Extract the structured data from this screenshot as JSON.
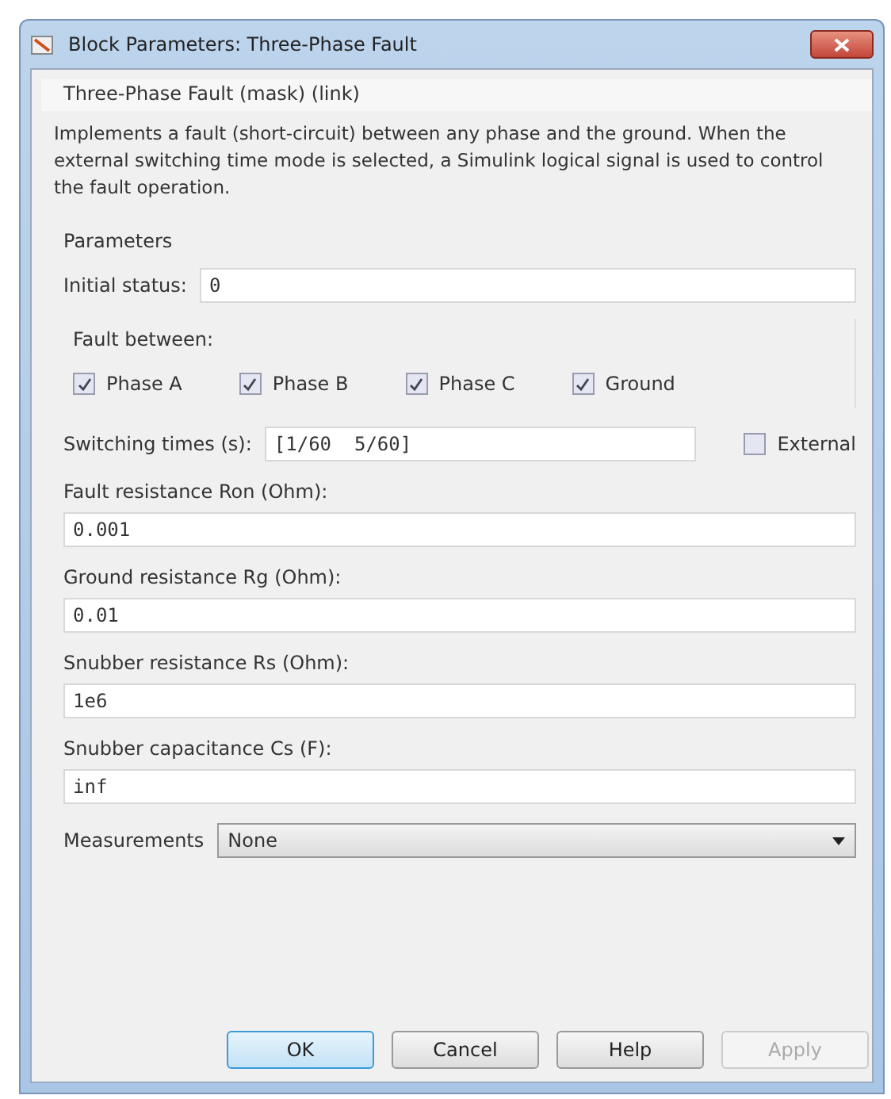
{
  "window": {
    "title": "Block Parameters: Three-Phase Fault"
  },
  "block_header": "Three-Phase Fault (mask) (link)",
  "description": "Implements a fault (short-circuit) between any phase and the ground. When the external switching time mode is selected, a Simulink logical signal is used to control the fault operation.",
  "parameters_label": "Parameters",
  "initial_status": {
    "label": "Initial status:",
    "value": "0"
  },
  "fault_between": {
    "label": "Fault between:",
    "options": [
      {
        "label": "Phase A",
        "checked": true
      },
      {
        "label": "Phase B",
        "checked": true
      },
      {
        "label": "Phase C",
        "checked": true
      },
      {
        "label": "Ground",
        "checked": true
      }
    ]
  },
  "switching_times": {
    "label": "Switching times (s):",
    "value": "[1/60  5/60]",
    "external": {
      "label": "External",
      "checked": false
    }
  },
  "fields": [
    {
      "label": "Fault resistance Ron (Ohm):",
      "value": "0.001"
    },
    {
      "label": "Ground resistance Rg (Ohm):",
      "value": "0.01"
    },
    {
      "label": "Snubber resistance Rs (Ohm):",
      "value": "1e6"
    },
    {
      "label": "Snubber capacitance Cs (F):",
      "value": "inf"
    }
  ],
  "measurements": {
    "label": "Measurements",
    "value": "None"
  },
  "buttons": [
    {
      "label": "OK",
      "default": true,
      "disabled": false
    },
    {
      "label": "Cancel",
      "default": false,
      "disabled": false
    },
    {
      "label": "Help",
      "default": false,
      "disabled": false
    },
    {
      "label": "Apply",
      "default": false,
      "disabled": true
    }
  ]
}
